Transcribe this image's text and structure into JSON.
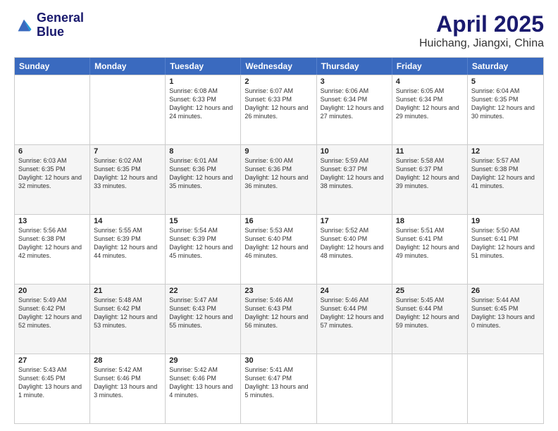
{
  "header": {
    "logo_line1": "General",
    "logo_line2": "Blue",
    "title": "April 2025",
    "subtitle": "Huichang, Jiangxi, China"
  },
  "weekdays": [
    "Sunday",
    "Monday",
    "Tuesday",
    "Wednesday",
    "Thursday",
    "Friday",
    "Saturday"
  ],
  "rows": [
    [
      {
        "day": "",
        "info": ""
      },
      {
        "day": "",
        "info": ""
      },
      {
        "day": "1",
        "info": "Sunrise: 6:08 AM\nSunset: 6:33 PM\nDaylight: 12 hours and 24 minutes."
      },
      {
        "day": "2",
        "info": "Sunrise: 6:07 AM\nSunset: 6:33 PM\nDaylight: 12 hours and 26 minutes."
      },
      {
        "day": "3",
        "info": "Sunrise: 6:06 AM\nSunset: 6:34 PM\nDaylight: 12 hours and 27 minutes."
      },
      {
        "day": "4",
        "info": "Sunrise: 6:05 AM\nSunset: 6:34 PM\nDaylight: 12 hours and 29 minutes."
      },
      {
        "day": "5",
        "info": "Sunrise: 6:04 AM\nSunset: 6:35 PM\nDaylight: 12 hours and 30 minutes."
      }
    ],
    [
      {
        "day": "6",
        "info": "Sunrise: 6:03 AM\nSunset: 6:35 PM\nDaylight: 12 hours and 32 minutes."
      },
      {
        "day": "7",
        "info": "Sunrise: 6:02 AM\nSunset: 6:35 PM\nDaylight: 12 hours and 33 minutes."
      },
      {
        "day": "8",
        "info": "Sunrise: 6:01 AM\nSunset: 6:36 PM\nDaylight: 12 hours and 35 minutes."
      },
      {
        "day": "9",
        "info": "Sunrise: 6:00 AM\nSunset: 6:36 PM\nDaylight: 12 hours and 36 minutes."
      },
      {
        "day": "10",
        "info": "Sunrise: 5:59 AM\nSunset: 6:37 PM\nDaylight: 12 hours and 38 minutes."
      },
      {
        "day": "11",
        "info": "Sunrise: 5:58 AM\nSunset: 6:37 PM\nDaylight: 12 hours and 39 minutes."
      },
      {
        "day": "12",
        "info": "Sunrise: 5:57 AM\nSunset: 6:38 PM\nDaylight: 12 hours and 41 minutes."
      }
    ],
    [
      {
        "day": "13",
        "info": "Sunrise: 5:56 AM\nSunset: 6:38 PM\nDaylight: 12 hours and 42 minutes."
      },
      {
        "day": "14",
        "info": "Sunrise: 5:55 AM\nSunset: 6:39 PM\nDaylight: 12 hours and 44 minutes."
      },
      {
        "day": "15",
        "info": "Sunrise: 5:54 AM\nSunset: 6:39 PM\nDaylight: 12 hours and 45 minutes."
      },
      {
        "day": "16",
        "info": "Sunrise: 5:53 AM\nSunset: 6:40 PM\nDaylight: 12 hours and 46 minutes."
      },
      {
        "day": "17",
        "info": "Sunrise: 5:52 AM\nSunset: 6:40 PM\nDaylight: 12 hours and 48 minutes."
      },
      {
        "day": "18",
        "info": "Sunrise: 5:51 AM\nSunset: 6:41 PM\nDaylight: 12 hours and 49 minutes."
      },
      {
        "day": "19",
        "info": "Sunrise: 5:50 AM\nSunset: 6:41 PM\nDaylight: 12 hours and 51 minutes."
      }
    ],
    [
      {
        "day": "20",
        "info": "Sunrise: 5:49 AM\nSunset: 6:42 PM\nDaylight: 12 hours and 52 minutes."
      },
      {
        "day": "21",
        "info": "Sunrise: 5:48 AM\nSunset: 6:42 PM\nDaylight: 12 hours and 53 minutes."
      },
      {
        "day": "22",
        "info": "Sunrise: 5:47 AM\nSunset: 6:43 PM\nDaylight: 12 hours and 55 minutes."
      },
      {
        "day": "23",
        "info": "Sunrise: 5:46 AM\nSunset: 6:43 PM\nDaylight: 12 hours and 56 minutes."
      },
      {
        "day": "24",
        "info": "Sunrise: 5:46 AM\nSunset: 6:44 PM\nDaylight: 12 hours and 57 minutes."
      },
      {
        "day": "25",
        "info": "Sunrise: 5:45 AM\nSunset: 6:44 PM\nDaylight: 12 hours and 59 minutes."
      },
      {
        "day": "26",
        "info": "Sunrise: 5:44 AM\nSunset: 6:45 PM\nDaylight: 13 hours and 0 minutes."
      }
    ],
    [
      {
        "day": "27",
        "info": "Sunrise: 5:43 AM\nSunset: 6:45 PM\nDaylight: 13 hours and 1 minute."
      },
      {
        "day": "28",
        "info": "Sunrise: 5:42 AM\nSunset: 6:46 PM\nDaylight: 13 hours and 3 minutes."
      },
      {
        "day": "29",
        "info": "Sunrise: 5:42 AM\nSunset: 6:46 PM\nDaylight: 13 hours and 4 minutes."
      },
      {
        "day": "30",
        "info": "Sunrise: 5:41 AM\nSunset: 6:47 PM\nDaylight: 13 hours and 5 minutes."
      },
      {
        "day": "",
        "info": ""
      },
      {
        "day": "",
        "info": ""
      },
      {
        "day": "",
        "info": ""
      }
    ]
  ]
}
